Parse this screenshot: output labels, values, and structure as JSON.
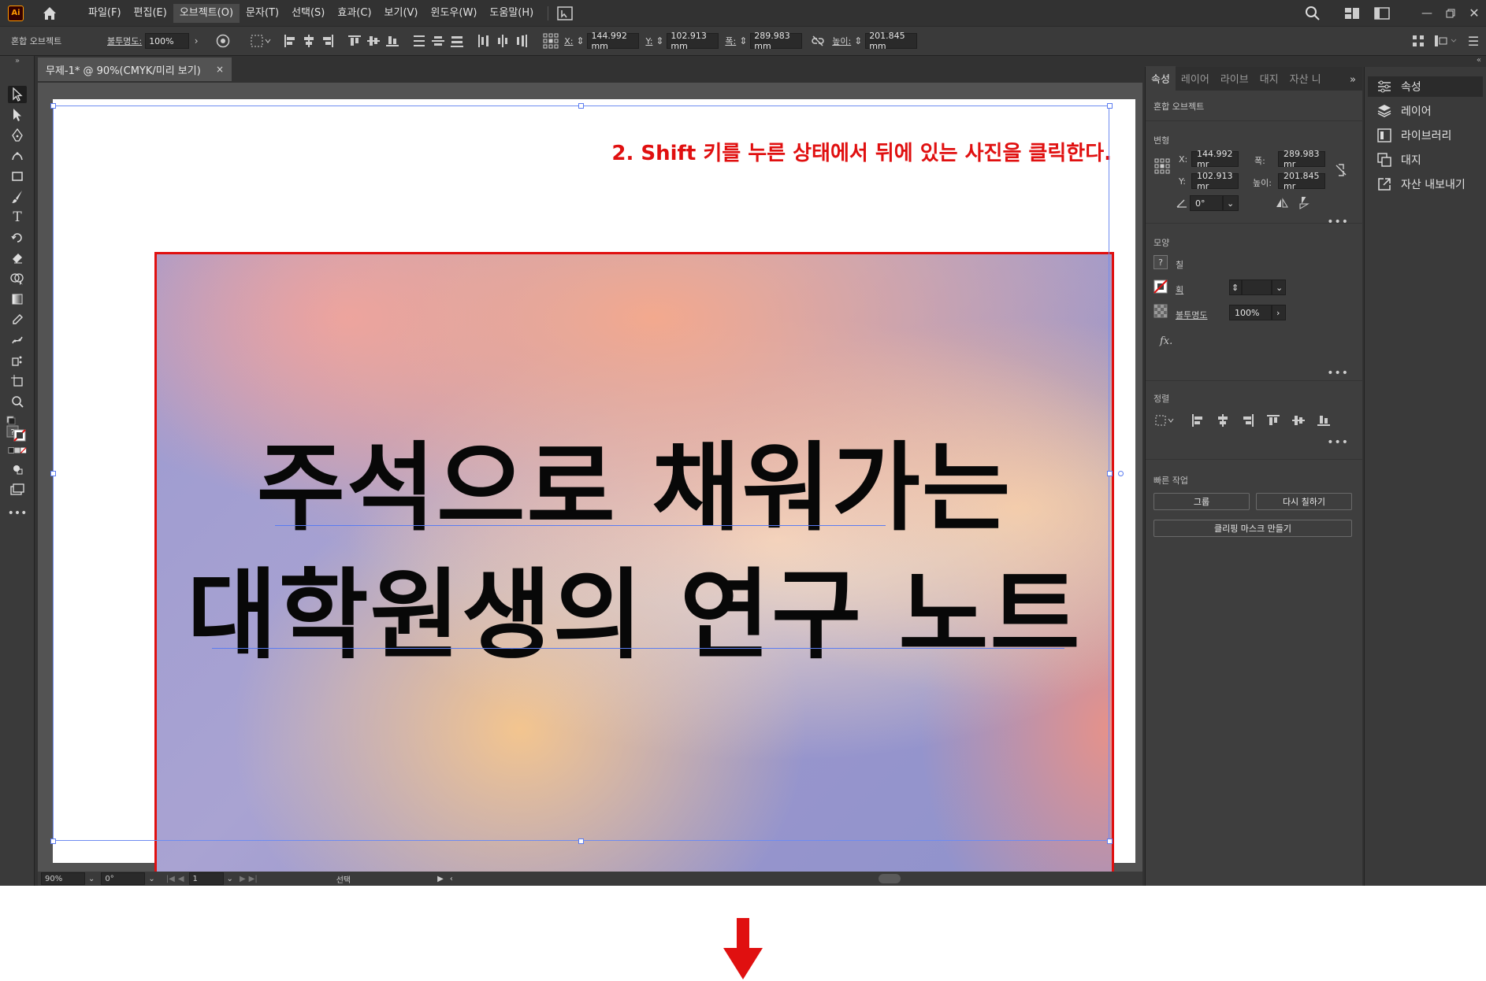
{
  "app": {
    "logo": "Ai"
  },
  "menus": [
    "파일(F)",
    "편집(E)",
    "오브젝트(O)",
    "문자(T)",
    "선택(S)",
    "효과(C)",
    "보기(V)",
    "윈도우(W)",
    "도움말(H)"
  ],
  "control_bar": {
    "object_type": "혼합 오브젝트",
    "opacity_label": "불투명도:",
    "opacity_value": "100%",
    "x_label": "X:",
    "x_value": "144.992 mm",
    "y_label": "Y:",
    "y_value": "102.913 mm",
    "w_label": "폭:",
    "w_value": "289.983 mm",
    "h_label": "높이:",
    "h_value": "201.845 mm"
  },
  "document_tab": {
    "title": "무제-1* @ 90%(CMYK/미리 보기)",
    "close": "×"
  },
  "canvas": {
    "annotation": "2. Shift 키를 누른 상태에서 뒤에 있는 사진을 클릭한다.",
    "headline_line1": "주석으로 채워가는",
    "headline_line2": "대학원생의 연구 노트",
    "annotation_color": "#e01010"
  },
  "status_bar": {
    "zoom": "90%",
    "rotation": "0°",
    "artboard": "1",
    "tool": "선택"
  },
  "properties_panel": {
    "tabs": [
      "속성",
      "레이어",
      "라이브",
      "대지",
      "자산 니"
    ],
    "object_type": "혼합 오브젝트",
    "transform_title": "변형",
    "x_label": "X:",
    "x_value": "144.992 mr",
    "y_label": "Y:",
    "y_value": "102.913 mr",
    "w_label": "폭:",
    "w_value": "289.983 mr",
    "h_label": "높이:",
    "h_value": "201.845 mr",
    "angle_value": "0°",
    "appearance_title": "모양",
    "fill_label": "칠",
    "stroke_label": "획",
    "opacity_label": "불투명도",
    "opacity_value": "100%",
    "fx_label": "fx.",
    "align_title": "정렬",
    "quick_actions_title": "빠른 작업",
    "btn_group": "그룹",
    "btn_recolor": "다시 칠하기",
    "btn_clipping_mask": "클리핑 마스크 만들기"
  },
  "dock": {
    "items": [
      "속성",
      "레이어",
      "라이브러리",
      "대지",
      "자산 내보내기"
    ]
  }
}
